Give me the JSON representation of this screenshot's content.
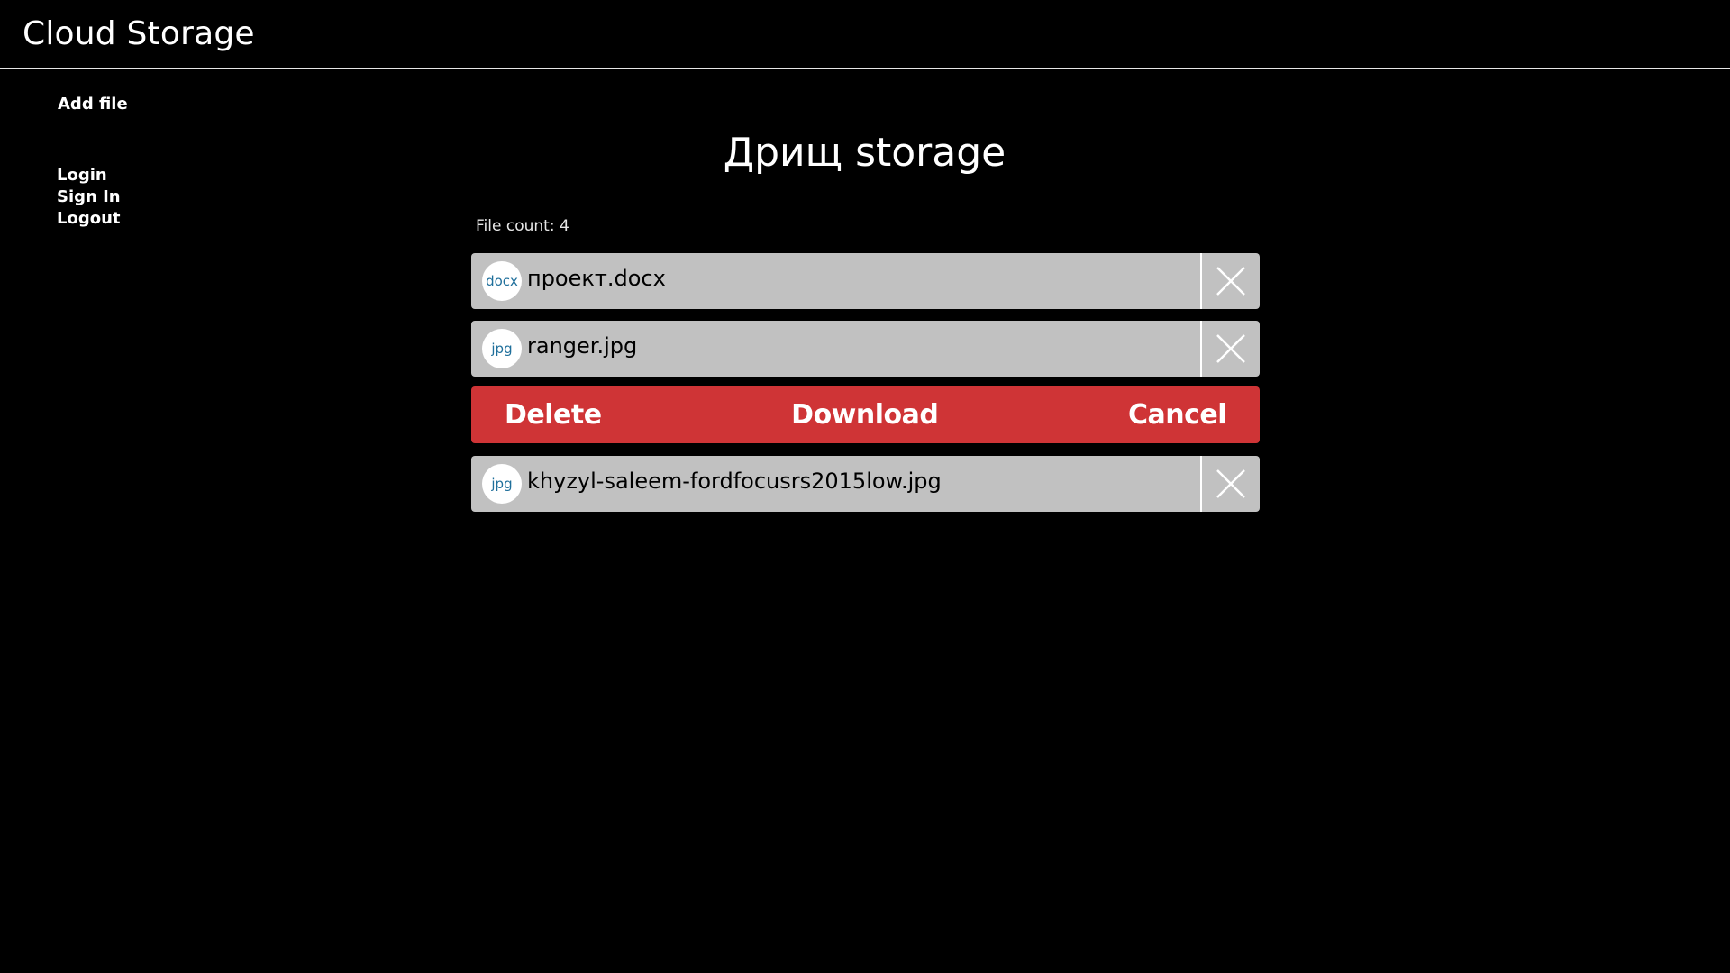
{
  "header": {
    "title": "Cloud Storage"
  },
  "sidebar": {
    "add_file": "Add file",
    "auth": {
      "login": "Login",
      "sign_in": "Sign In",
      "logout": "Logout"
    }
  },
  "main": {
    "title": "Дрищ storage",
    "file_count": "File count: 4",
    "files": [
      {
        "ext": "docx",
        "name": "проект.docx"
      },
      {
        "ext": "jpg",
        "name": "ranger.jpg"
      },
      {
        "ext": "jpg",
        "name": "khyzyl-saleem-fordfocusrs2015low.jpg"
      }
    ],
    "actions": {
      "delete": "Delete",
      "download": "Download",
      "cancel": "Cancel"
    }
  },
  "colors": {
    "background": "#000000",
    "row_background": "#c1c1c1",
    "action_bar": "#cf3436",
    "icon_text": "#1f6f9b"
  },
  "icons": {
    "close": "close-x-icon"
  }
}
